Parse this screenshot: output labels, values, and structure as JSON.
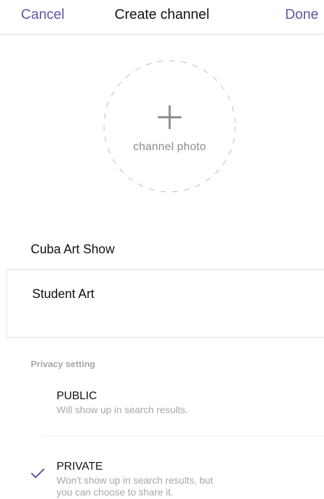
{
  "nav": {
    "cancel_label": "Cancel",
    "title": "Create channel",
    "done_label": "Done"
  },
  "photo": {
    "label": "channel photo",
    "icon": "plus-icon"
  },
  "form": {
    "channel_name": "Cuba Art Show",
    "description": "Student Art"
  },
  "privacy": {
    "header": "Privacy setting",
    "options": [
      {
        "title": "PUBLIC",
        "description": "Will show up in search results.",
        "selected": false
      },
      {
        "title": "PRIVATE",
        "description_line1": "Won't show up in search results, but",
        "description_line2": "you can choose to share it.",
        "selected": true,
        "icon": "checkmark-icon"
      }
    ]
  },
  "colors": {
    "accent": "#5b58a6",
    "muted_text": "#a7a7a7",
    "divider": "#e4e4e4"
  }
}
